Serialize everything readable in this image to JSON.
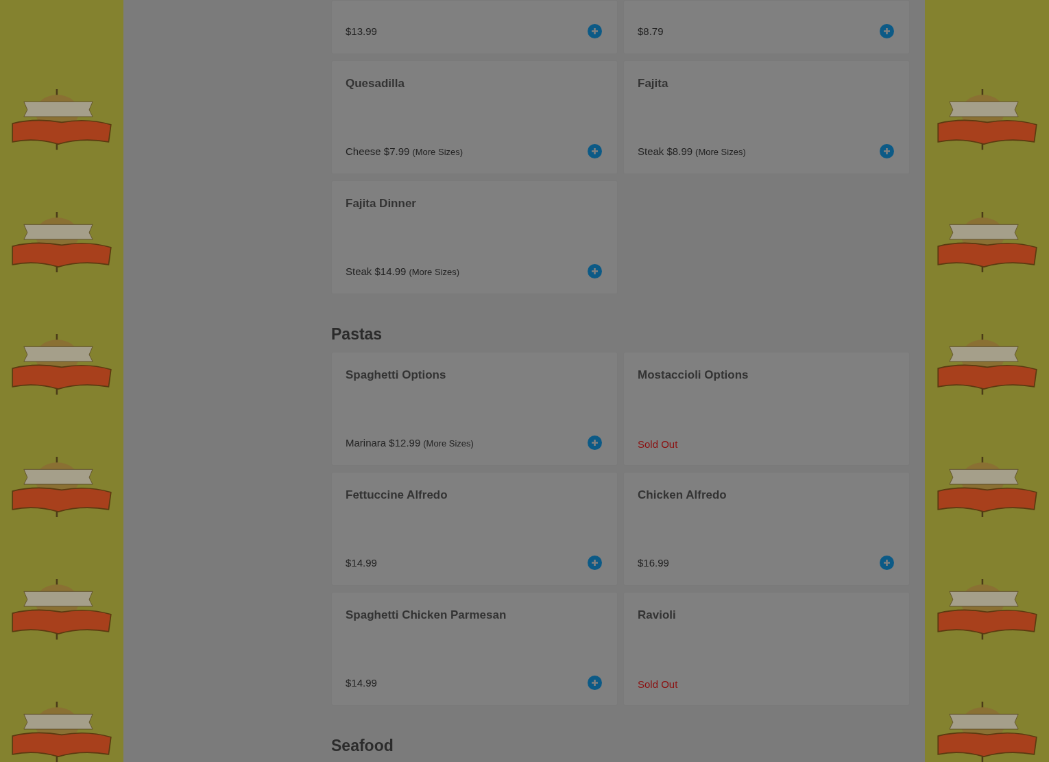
{
  "sections": [
    {
      "items": [
        {
          "kind": "price",
          "price": "$13.99"
        },
        {
          "kind": "price",
          "price": "$8.79"
        },
        {
          "kind": "sized",
          "title": "Quesadilla",
          "price": "Cheese $7.99",
          "more": "(More Sizes)"
        },
        {
          "kind": "sized",
          "title": "Fajita",
          "price": "Steak $8.99",
          "more": "(More Sizes)"
        },
        {
          "kind": "sized",
          "title": "Fajita Dinner",
          "price": "Steak $14.99",
          "more": "(More Sizes)"
        }
      ]
    },
    {
      "heading": "Pastas",
      "items": [
        {
          "kind": "sized",
          "title": "Spaghetti Options",
          "price": "Marinara $12.99",
          "more": "(More Sizes)"
        },
        {
          "kind": "sold_out",
          "title": "Mostaccioli Options",
          "price": "Sold Out"
        },
        {
          "kind": "price",
          "title": "Fettuccine Alfredo",
          "price": "$14.99"
        },
        {
          "kind": "price",
          "title": "Chicken Alfredo",
          "price": "$16.99"
        },
        {
          "kind": "price",
          "title": "Spaghetti Chicken Parmesan",
          "price": "$14.99"
        },
        {
          "kind": "sold_out",
          "title": "Ravioli",
          "price": "Sold Out"
        }
      ]
    },
    {
      "heading": "Seafood"
    }
  ]
}
